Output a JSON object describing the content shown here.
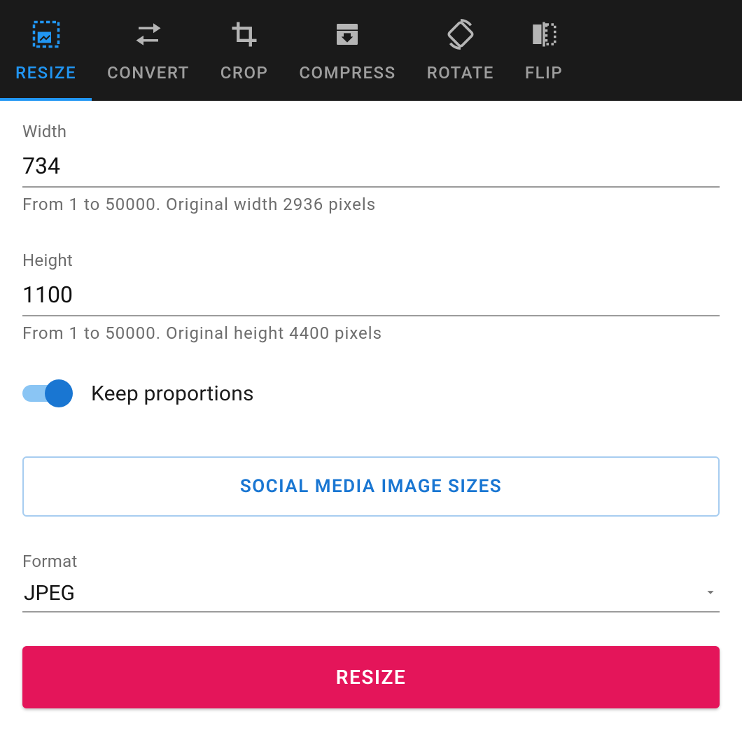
{
  "tabs": {
    "resize": "RESIZE",
    "convert": "CONVERT",
    "crop": "CROP",
    "compress": "COMPRESS",
    "rotate": "ROTATE",
    "flip": "FLIP"
  },
  "width": {
    "label": "Width",
    "value": "734",
    "hint": "From 1 to 50000. Original width 2936 pixels"
  },
  "height": {
    "label": "Height",
    "value": "1100",
    "hint": "From 1 to 50000. Original height 4400 pixels"
  },
  "keep_proportions": {
    "label": "Keep proportions",
    "on": true
  },
  "social_button": "SOCIAL MEDIA IMAGE SIZES",
  "format": {
    "label": "Format",
    "value": "JPEG"
  },
  "resize_button": "RESIZE"
}
